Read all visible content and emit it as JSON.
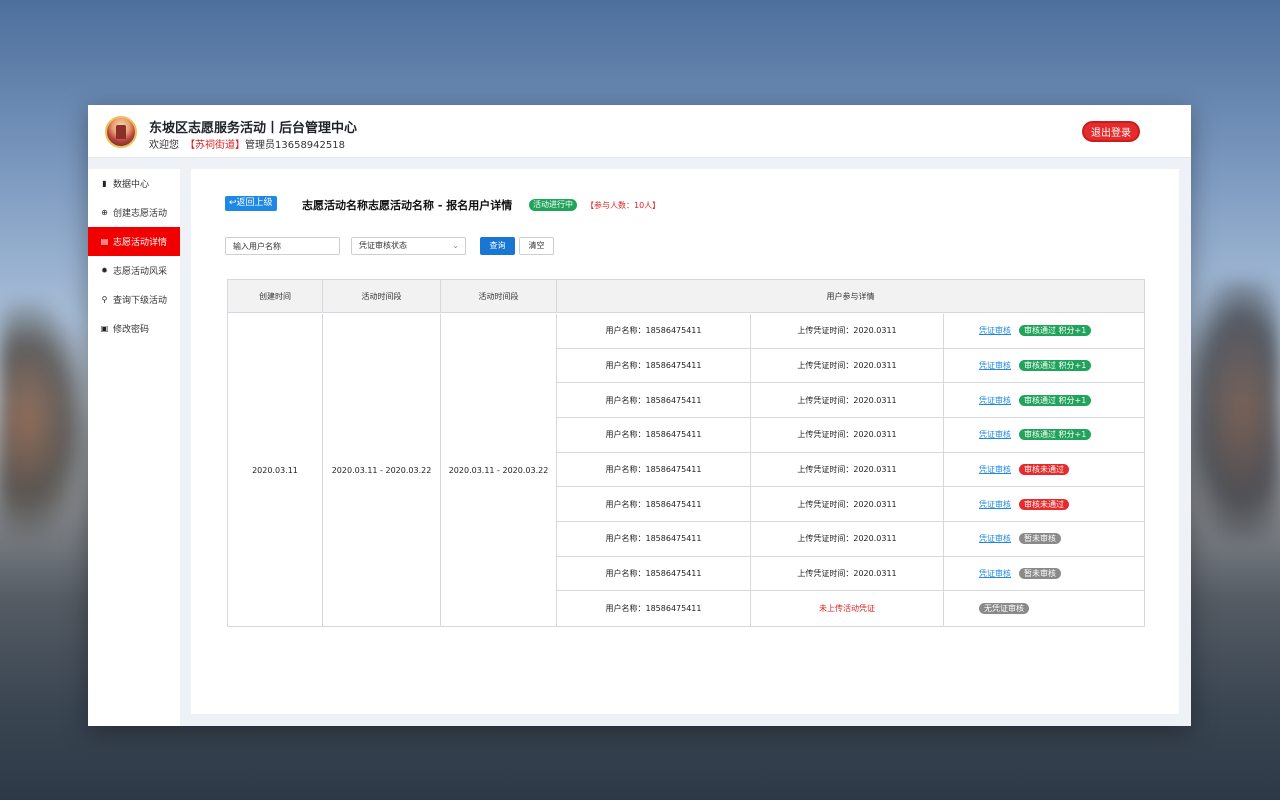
{
  "header": {
    "title": "东坡区志愿服务活动丨后台管理中心",
    "welcome_prefix": "欢迎您",
    "street": "【苏祠街道】",
    "admin": "管理员13658942518",
    "logout_label": "退出登录"
  },
  "sidebar": {
    "items": [
      {
        "label": "数据中心",
        "icon": "bar-chart-icon",
        "active": false
      },
      {
        "label": "创建志愿活动",
        "icon": "plus-circle-icon",
        "active": false
      },
      {
        "label": "志愿活动详情",
        "icon": "document-icon",
        "active": true
      },
      {
        "label": "志愿活动风采",
        "icon": "gear-icon",
        "active": false
      },
      {
        "label": "查询下级活动",
        "icon": "search-icon",
        "active": false
      },
      {
        "label": "修改密码",
        "icon": "id-card-icon",
        "active": false
      }
    ]
  },
  "toolbar": {
    "back_label": "返回上级",
    "heading": "志愿活动名称志愿活动名称 - 报名用户详情",
    "status": "活动进行中",
    "count": "【参与人数：10人】"
  },
  "filters": {
    "search_value": "输入用户名称",
    "select_value": "凭证审核状态",
    "query_label": "查询",
    "clear_label": "清空"
  },
  "table": {
    "headers": [
      "创建时间",
      "活动时间段",
      "活动时间段",
      "用户参与详情"
    ],
    "created": "2020.03.11",
    "period1": "2020.03.11 - 2020.03.22",
    "period2": "2020.03.11 - 2020.03.22",
    "rows": [
      {
        "user": "用户名称：18586475411",
        "upload": "上传凭证时间：2020.0311",
        "link": "凭证审核",
        "badge": "审核通过 积分+1",
        "badge_type": "green"
      },
      {
        "user": "用户名称：18586475411",
        "upload": "上传凭证时间：2020.0311",
        "link": "凭证审核",
        "badge": "审核通过 积分+1",
        "badge_type": "green"
      },
      {
        "user": "用户名称：18586475411",
        "upload": "上传凭证时间：2020.0311",
        "link": "凭证审核",
        "badge": "审核通过 积分+1",
        "badge_type": "green"
      },
      {
        "user": "用户名称：18586475411",
        "upload": "上传凭证时间：2020.0311",
        "link": "凭证审核",
        "badge": "审核通过 积分+1",
        "badge_type": "green"
      },
      {
        "user": "用户名称：18586475411",
        "upload": "上传凭证时间：2020.0311",
        "link": "凭证审核",
        "badge": "审核未通过",
        "badge_type": "red"
      },
      {
        "user": "用户名称：18586475411",
        "upload": "上传凭证时间：2020.0311",
        "link": "凭证审核",
        "badge": "审核未通过",
        "badge_type": "red"
      },
      {
        "user": "用户名称：18586475411",
        "upload": "上传凭证时间：2020.0311",
        "link": "凭证审核",
        "badge": "暂未审核",
        "badge_type": "gray"
      },
      {
        "user": "用户名称：18586475411",
        "upload": "上传凭证时间：2020.0311",
        "link": "凭证审核",
        "badge": "暂未审核",
        "badge_type": "gray"
      },
      {
        "user": "用户名称：18586475411",
        "upload": "未上传活动凭证",
        "upload_red": true,
        "link": "",
        "badge": "无凭证审核",
        "badge_type": "gray"
      }
    ]
  }
}
